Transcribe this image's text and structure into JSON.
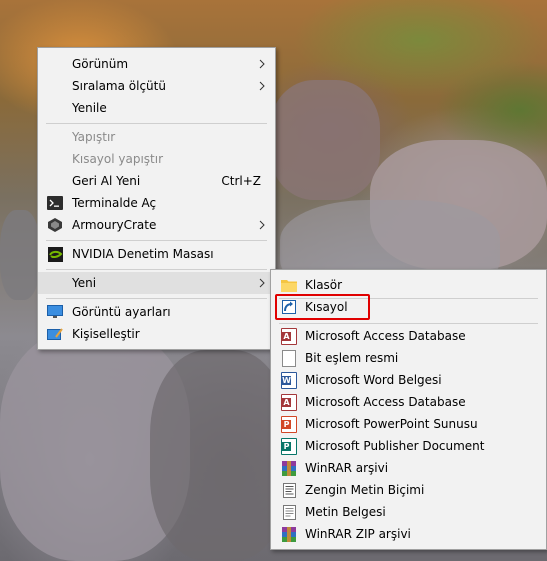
{
  "context_menu": {
    "items": [
      {
        "label": "Görünüm",
        "icon": "",
        "has_submenu": true,
        "enabled": true
      },
      {
        "label": "Sıralama ölçütü",
        "icon": "",
        "has_submenu": true,
        "enabled": true
      },
      {
        "label": "Yenile",
        "icon": "",
        "has_submenu": false,
        "enabled": true
      },
      {
        "label": "Yapıştır",
        "icon": "",
        "has_submenu": false,
        "enabled": false
      },
      {
        "label": "Kısayol yapıştır",
        "icon": "",
        "has_submenu": false,
        "enabled": false
      },
      {
        "label": "Geri Al Yeni",
        "shortcut": "Ctrl+Z",
        "icon": "",
        "has_submenu": false,
        "enabled": true
      },
      {
        "label": "Terminalde Aç",
        "icon": "terminal-icon",
        "has_submenu": false,
        "enabled": true
      },
      {
        "label": "ArmouryCrate",
        "icon": "armoury-crate-icon",
        "has_submenu": true,
        "enabled": true
      },
      {
        "label": "NVIDIA Denetim Masası",
        "icon": "nvidia-icon",
        "has_submenu": false,
        "enabled": true
      },
      {
        "label": "Yeni",
        "icon": "",
        "has_submenu": true,
        "enabled": true,
        "active": true
      },
      {
        "label": "Görüntü ayarları",
        "icon": "display-icon",
        "has_submenu": false,
        "enabled": true
      },
      {
        "label": "Kişiselleştir",
        "icon": "personalize-icon",
        "has_submenu": false,
        "enabled": true
      }
    ]
  },
  "new_submenu": {
    "highlighted": "Kısayol",
    "items": [
      {
        "label": "Klasör",
        "icon": "folder-icon"
      },
      {
        "label": "Kısayol",
        "icon": "shortcut-icon"
      },
      {
        "label": "Microsoft Access Database",
        "icon": "access-icon"
      },
      {
        "label": "Bit eşlem resmi",
        "icon": "bitmap-icon"
      },
      {
        "label": "Microsoft Word Belgesi",
        "icon": "word-icon"
      },
      {
        "label": "Microsoft Access Database",
        "icon": "access-icon"
      },
      {
        "label": "Microsoft PowerPoint Sunusu",
        "icon": "powerpoint-icon"
      },
      {
        "label": "Microsoft Publisher Document",
        "icon": "publisher-icon"
      },
      {
        "label": "WinRAR arşivi",
        "icon": "winrar-icon"
      },
      {
        "label": "Zengin Metin Biçimi",
        "icon": "rtf-icon"
      },
      {
        "label": "Metin Belgesi",
        "icon": "text-file-icon"
      },
      {
        "label": "WinRAR ZIP arşivi",
        "icon": "winrar-zip-icon"
      }
    ]
  },
  "colors": {
    "menu_bg": "#f2f2f2",
    "highlight_border": "#e00000",
    "disabled_text": "#8a8a8a",
    "access": "#a4373a",
    "word": "#2b579a",
    "powerpoint": "#d24726",
    "publisher": "#077568",
    "nvidia": "#76b900"
  }
}
